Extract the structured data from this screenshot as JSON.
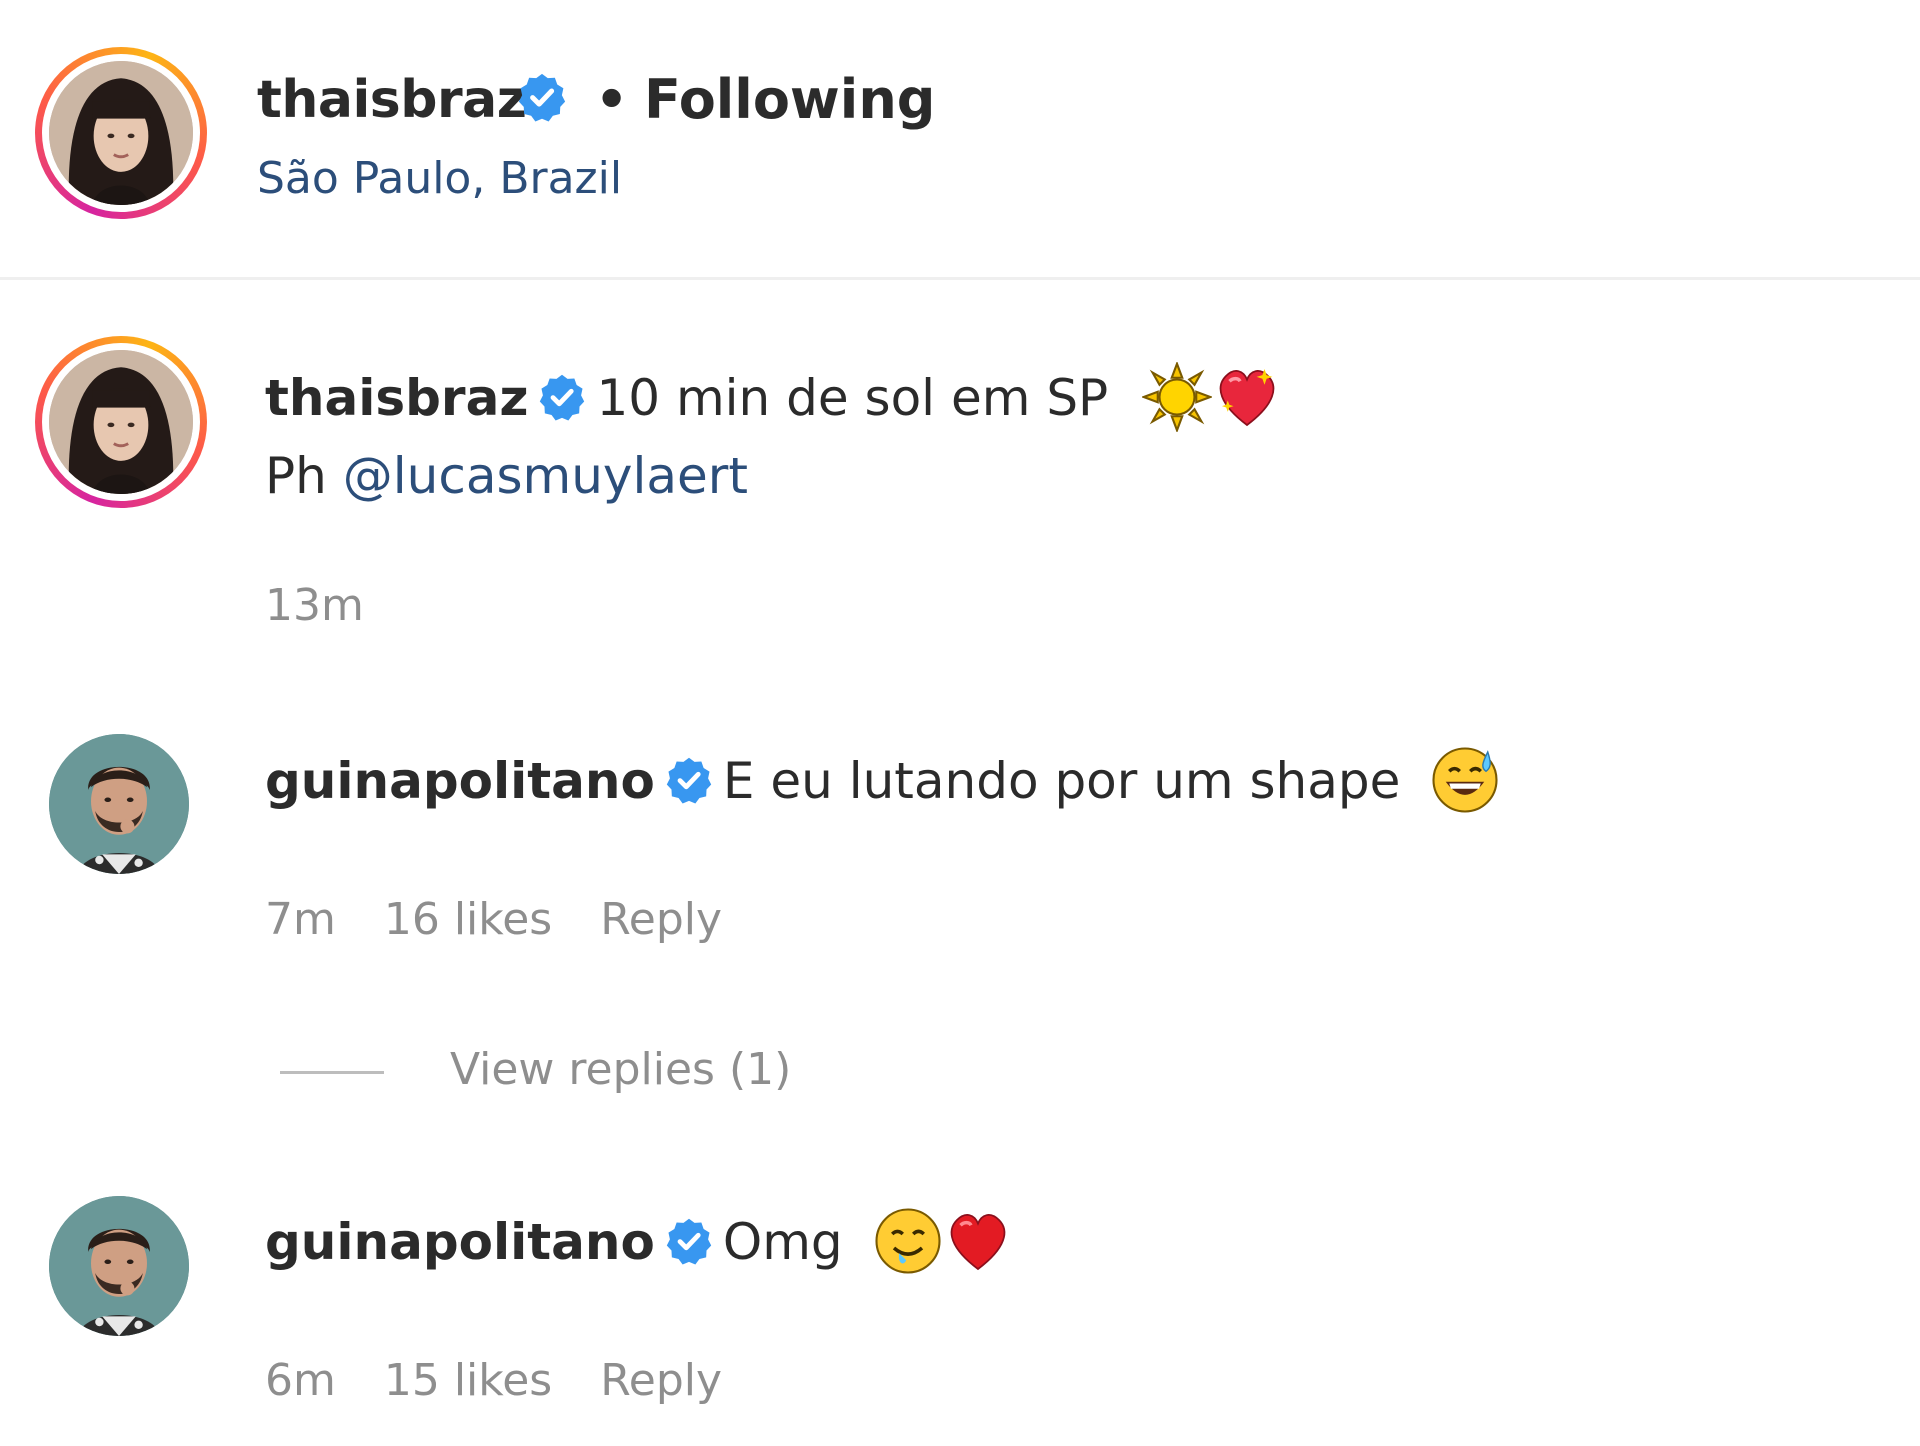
{
  "post": {
    "username": "thaisbraz",
    "separator": "•",
    "follow_status": "Following",
    "location": "São Paulo, Brazil"
  },
  "caption": {
    "username": "thaisbraz",
    "text": "10 min de sol em SP",
    "emojis": [
      "sun-emoji",
      "sparkling-heart-emoji"
    ],
    "line2_prefix": "Ph",
    "mention": "@lucasmuylaert",
    "time": "13m"
  },
  "comments": [
    {
      "username": "guinapolitano",
      "text": "E eu lutando por um shape",
      "emojis": [
        "grinning-sweat-emoji"
      ],
      "time": "7m",
      "likes": "16 likes",
      "reply_label": "Reply",
      "view_replies": "View replies (1)"
    },
    {
      "username": "guinapolitano",
      "text": "Omg",
      "emojis": [
        "drooling-face-emoji",
        "red-heart-emoji"
      ],
      "time": "6m",
      "likes": "15 likes",
      "reply_label": "Reply"
    }
  ],
  "colors": {
    "text": "#2b2b2b",
    "link": "#2c4e7a",
    "meta": "#8e8e8e",
    "verified": "#3897f0",
    "divider": "#efefef"
  }
}
